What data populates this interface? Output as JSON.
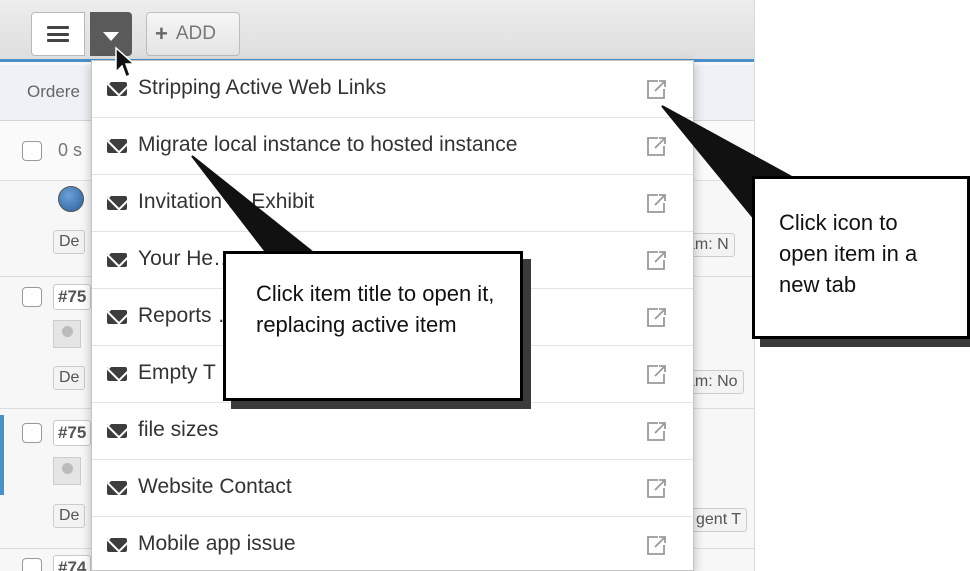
{
  "toolbar": {
    "add_label": "ADD"
  },
  "sortbar": {
    "label": "Ordere"
  },
  "selection": {
    "label": "0 s"
  },
  "tickets": [
    {
      "num": "#75",
      "tag": "De",
      "right_tag": "am: N"
    },
    {
      "num": "#75",
      "tag": "De",
      "right_tag": "am: No"
    },
    {
      "num": "#75",
      "tag": "De",
      "right_tag": "gent T"
    },
    {
      "num": "#74"
    }
  ],
  "dropdown": {
    "items": [
      {
        "title": "Stripping Active Web Links"
      },
      {
        "title": "Migrate local instance to hosted instance"
      },
      {
        "title": "Invitation to Exhibit"
      },
      {
        "title": "Your He…                              …note…"
      },
      {
        "title": "Reports                                    …rop…"
      },
      {
        "title": "Empty T"
      },
      {
        "title": "file sizes"
      },
      {
        "title": "Website Contact"
      },
      {
        "title": "Mobile app issue"
      }
    ]
  },
  "callouts": {
    "left": "Click item title to open it, replacing active item",
    "right": "Click icon to open item in a new tab"
  }
}
